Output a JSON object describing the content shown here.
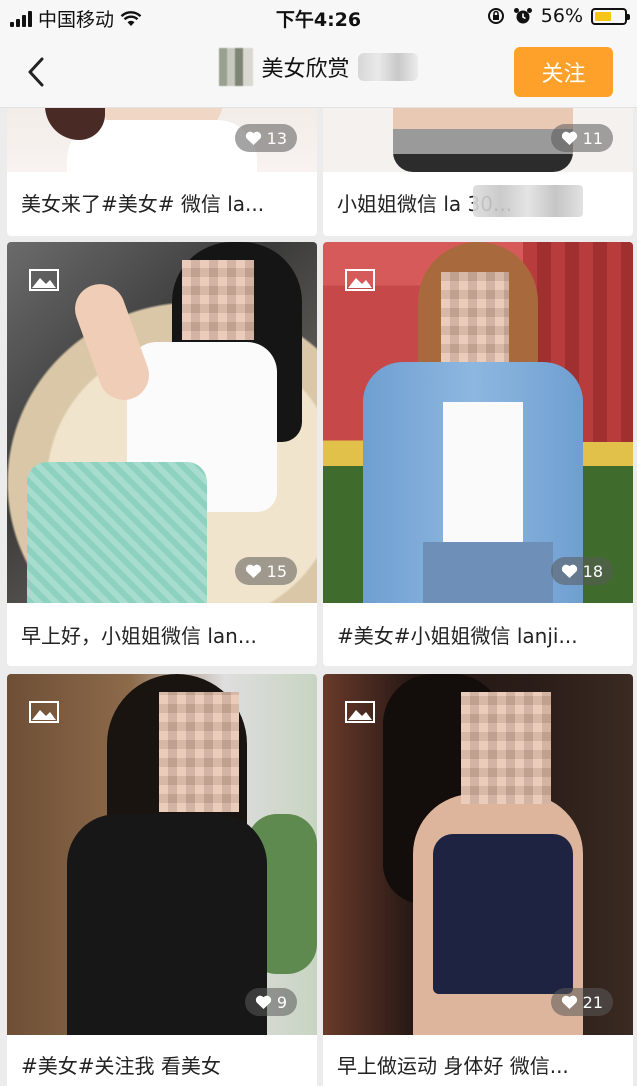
{
  "status_bar": {
    "carrier": "中国移动",
    "time": "下午4:26",
    "battery": "56%",
    "battery_level": 0.56
  },
  "nav": {
    "title": "美女欣赏",
    "follow_label": "关注",
    "back_icon": "chevron-left-icon"
  },
  "colors": {
    "accent": "#fda12a",
    "battery": "#f5c518"
  },
  "cards": [
    {
      "caption": "美女来了#美女# 微信 la...",
      "likes": "13"
    },
    {
      "caption": "小姐姐微信 la            30...",
      "likes": "11"
    },
    {
      "caption": "早上好，小姐姐微信 lan...",
      "likes": "15"
    },
    {
      "caption": "#美女#小姐姐微信 lanji...",
      "likes": "18"
    },
    {
      "caption": "#美女#关注我 看美女",
      "likes": "9"
    },
    {
      "caption": "早上做运动 身体好 微信...",
      "likes": "21"
    }
  ]
}
